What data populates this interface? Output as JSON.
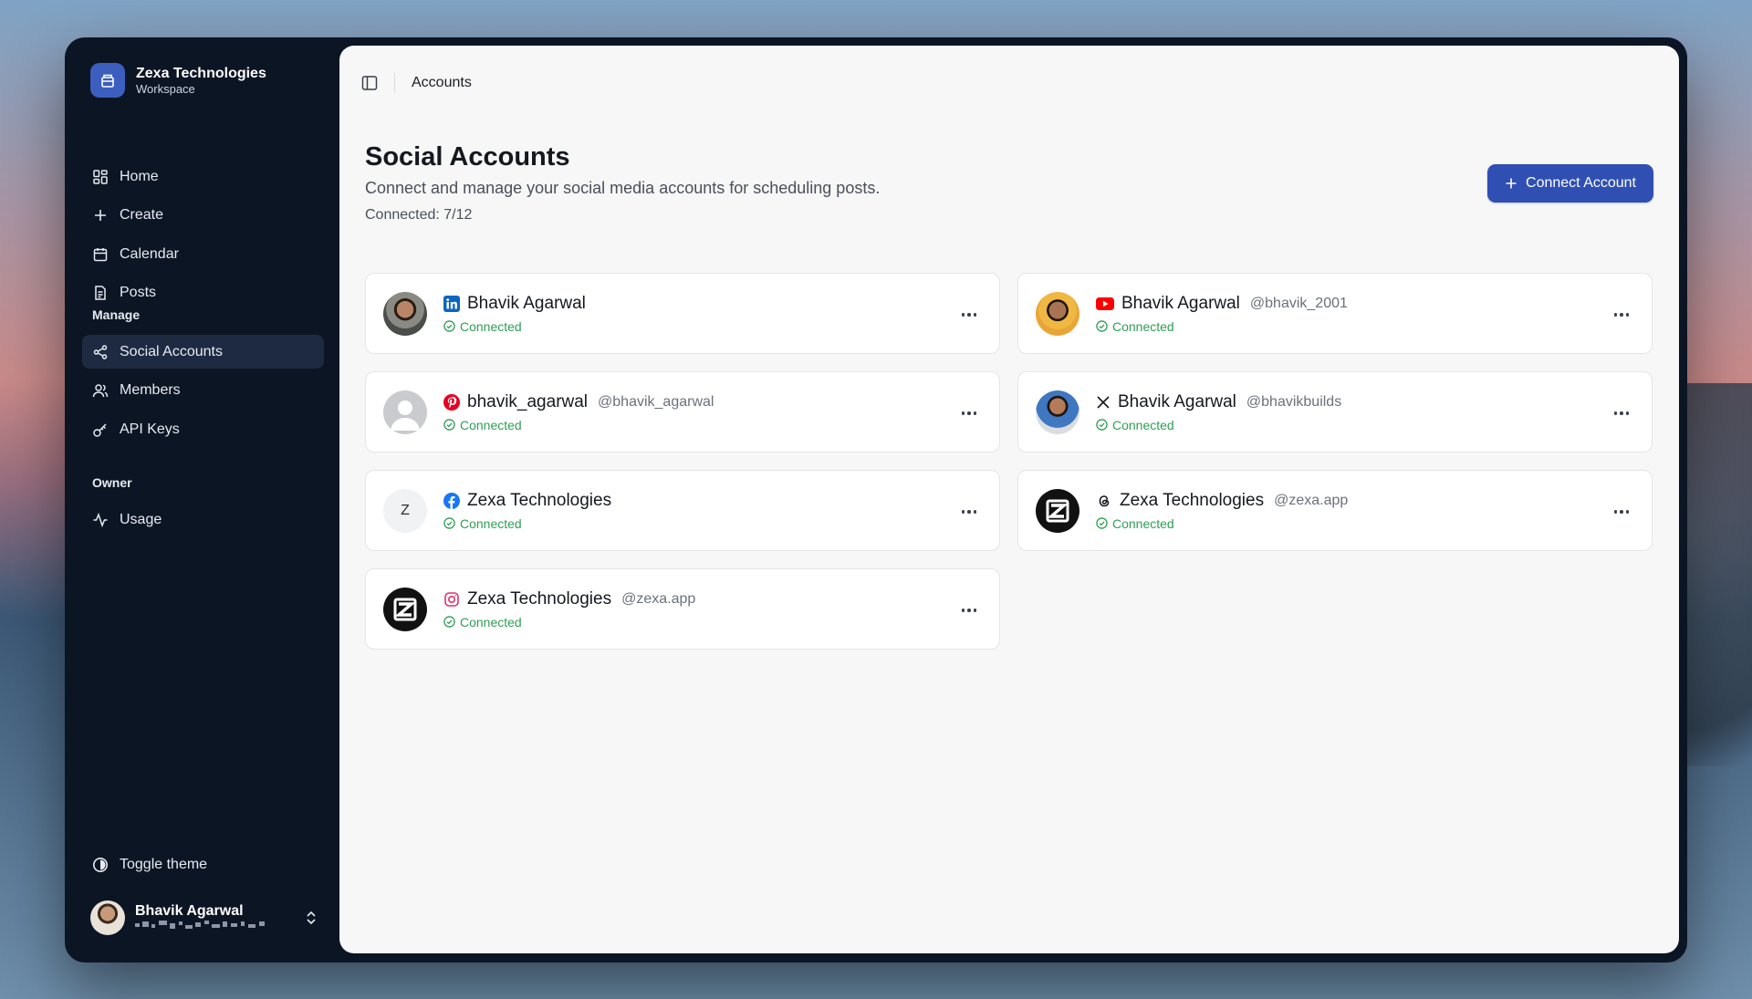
{
  "workspace": {
    "name": "Zexa Technologies",
    "subtitle": "Workspace"
  },
  "nav": {
    "main": [
      {
        "label": "Home",
        "icon": "home-grid-icon"
      },
      {
        "label": "Create",
        "icon": "plus-icon"
      },
      {
        "label": "Calendar",
        "icon": "calendar-icon"
      },
      {
        "label": "Posts",
        "icon": "document-icon"
      }
    ],
    "manage_label": "Manage",
    "manage": [
      {
        "label": "Social Accounts",
        "icon": "share-icon",
        "active": true
      },
      {
        "label": "Members",
        "icon": "users-icon"
      },
      {
        "label": "API Keys",
        "icon": "key-icon"
      }
    ],
    "owner_label": "Owner",
    "owner": [
      {
        "label": "Usage",
        "icon": "activity-icon"
      }
    ]
  },
  "footer": {
    "toggle_theme": "Toggle theme",
    "user_name": "Bhavik Agarwal"
  },
  "topbar": {
    "breadcrumb": "Accounts"
  },
  "page": {
    "title": "Social Accounts",
    "subtitle": "Connect and manage your social media accounts for scheduling posts.",
    "count": "Connected: 7/12",
    "connect_button": "Connect Account"
  },
  "accounts": [
    {
      "name": "Bhavik Agarwal",
      "handle": "",
      "platform": "linkedin",
      "status": "Connected"
    },
    {
      "name": "Bhavik Agarwal",
      "handle": "@bhavik_2001",
      "platform": "youtube",
      "status": "Connected"
    },
    {
      "name": "bhavik_agarwal",
      "handle": "@bhavik_agarwal",
      "platform": "pinterest",
      "status": "Connected"
    },
    {
      "name": "Bhavik Agarwal",
      "handle": "@bhavikbuilds",
      "platform": "x",
      "status": "Connected"
    },
    {
      "name": "Zexa Technologies",
      "handle": "",
      "platform": "facebook",
      "status": "Connected",
      "avatar_letter": "Z"
    },
    {
      "name": "Zexa Technologies",
      "handle": "@zexa.app",
      "platform": "threads",
      "status": "Connected"
    },
    {
      "name": "Zexa Technologies",
      "handle": "@zexa.app",
      "platform": "instagram",
      "status": "Connected"
    }
  ],
  "colors": {
    "accent": "#2f4fb3",
    "connected": "#2f9e55",
    "sidebar_bg": "#0c1524",
    "linkedin": "#0a66c2",
    "youtube": "#ff0000",
    "pinterest": "#e60023",
    "facebook": "#1877f2",
    "instagram": "#e1306c"
  }
}
